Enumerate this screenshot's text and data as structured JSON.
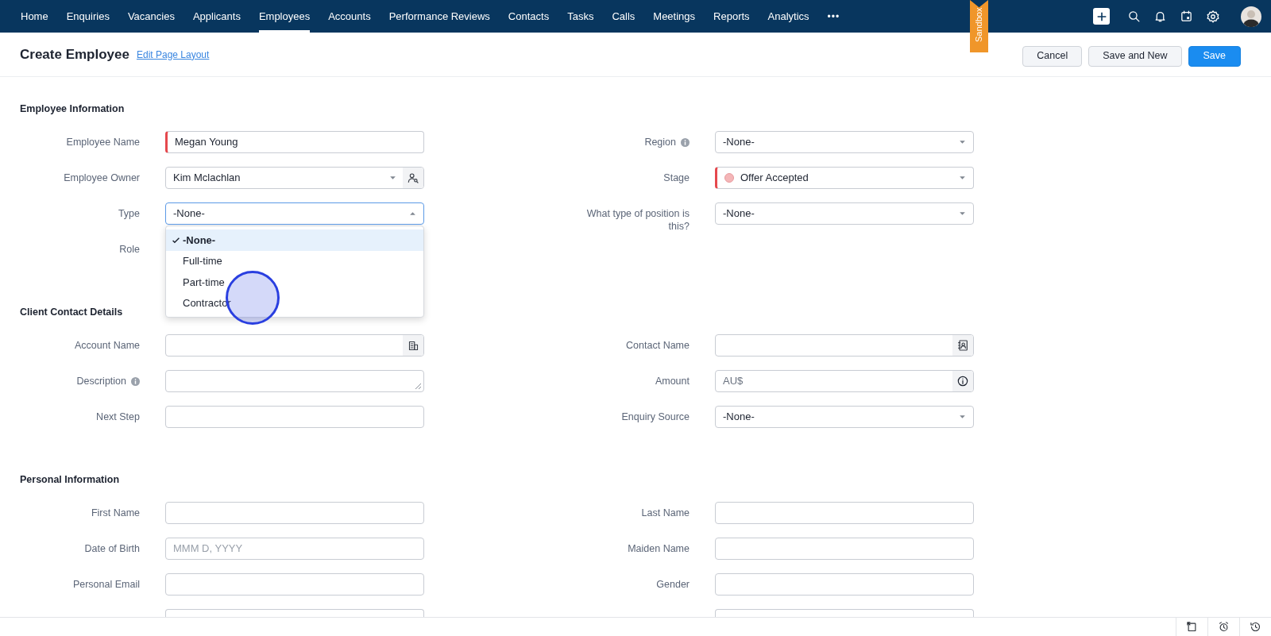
{
  "nav": {
    "items": [
      {
        "label": "Home",
        "selected": false
      },
      {
        "label": "Enquiries",
        "selected": false
      },
      {
        "label": "Vacancies",
        "selected": false
      },
      {
        "label": "Applicants",
        "selected": false
      },
      {
        "label": "Employees",
        "selected": true
      },
      {
        "label": "Accounts",
        "selected": false
      },
      {
        "label": "Performance Reviews",
        "selected": false
      },
      {
        "label": "Contacts",
        "selected": false
      },
      {
        "label": "Tasks",
        "selected": false
      },
      {
        "label": "Calls",
        "selected": false
      },
      {
        "label": "Meetings",
        "selected": false
      },
      {
        "label": "Reports",
        "selected": false
      },
      {
        "label": "Analytics",
        "selected": false
      }
    ],
    "more": "•••"
  },
  "ribbon": "Sandbox",
  "header": {
    "title": "Create Employee",
    "link": "Edit Page Layout",
    "buttons": [
      {
        "label": "Cancel",
        "kind": "secondary"
      },
      {
        "label": "Save and New",
        "kind": "secondary"
      },
      {
        "label": "Save",
        "kind": "primary"
      }
    ]
  },
  "sections": [
    {
      "title": "Employee Information",
      "left": [
        {
          "label": "Employee Name",
          "kind": "text",
          "value": "Megan Young",
          "required": true
        },
        {
          "label": "Employee Owner",
          "kind": "user_lookup",
          "value": "Kim Mclachlan",
          "required": false
        },
        {
          "label": "Type",
          "kind": "select",
          "value": "-None-",
          "required": false,
          "expanded": true,
          "options": [
            {
              "label": "-None-",
              "selected": true
            },
            {
              "label": "Full-time",
              "selected": false
            },
            {
              "label": "Part-time",
              "selected": false
            },
            {
              "label": "Contractor",
              "selected": false
            }
          ]
        },
        {
          "label": "Role",
          "kind": "covered"
        }
      ],
      "right": [
        {
          "label": "Region",
          "info_icon": true,
          "kind": "select",
          "value": "-None-",
          "required": false,
          "expanded": false
        },
        {
          "label": "Stage",
          "kind": "select",
          "value": "Offer Accepted",
          "color": "#f4b6b8",
          "required": true,
          "expanded": false
        },
        {
          "label": "What type of position is this?",
          "kind": "select",
          "value": "-None-",
          "required": false,
          "expanded": false
        }
      ]
    },
    {
      "title": "Client Contact Details",
      "left": [
        {
          "label": "Account Name",
          "kind": "account_lookup",
          "required": false
        },
        {
          "label": "Description",
          "info_icon": true,
          "kind": "textarea",
          "required": false
        },
        {
          "label": "Next Step",
          "kind": "text",
          "required": false
        }
      ],
      "right": [
        {
          "label": "Contact Name",
          "kind": "contact_lookup",
          "required": false
        },
        {
          "label": "Amount",
          "kind": "currency",
          "prefix": "AU$",
          "required": false
        },
        {
          "label": "Enquiry Source",
          "kind": "select",
          "value": "-None-",
          "required": false,
          "expanded": false
        }
      ]
    },
    {
      "title": "Personal Information",
      "left": [
        {
          "label": "First Name",
          "kind": "text",
          "required": false
        },
        {
          "label": "Date of Birth",
          "kind": "text",
          "placeholder": "MMM D, YYYY",
          "required": false
        },
        {
          "label": "Personal Email",
          "kind": "text",
          "required": false
        },
        {
          "kind": "text"
        }
      ],
      "right": [
        {
          "label": "Last Name",
          "kind": "text",
          "required": false
        },
        {
          "label": "Maiden Name",
          "kind": "text",
          "required": false
        },
        {
          "label": "Gender",
          "kind": "text",
          "required": false
        },
        {
          "kind": "text"
        }
      ]
    }
  ]
}
